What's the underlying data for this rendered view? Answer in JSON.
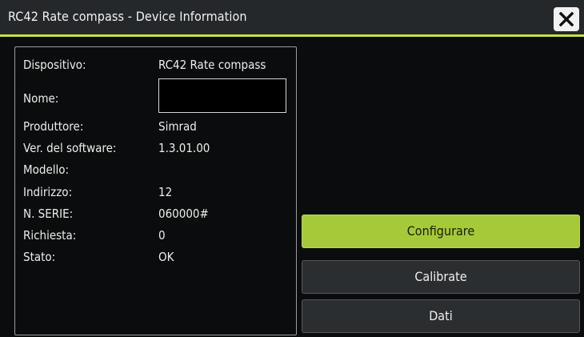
{
  "window": {
    "title": "RC42 Rate compass - Device Information"
  },
  "info": {
    "rows": [
      {
        "label": "Dispositivo:",
        "value": "RC42 Rate compass"
      },
      {
        "label": "Nome:",
        "value": ""
      },
      {
        "label": "Produttore:",
        "value": "Simrad"
      },
      {
        "label": "Ver. del software:",
        "value": "1.3.01.00"
      },
      {
        "label": "Modello:",
        "value": ""
      },
      {
        "label": "Indirizzo:",
        "value": "12"
      },
      {
        "label": "N. SERIE:",
        "value": "060000#"
      },
      {
        "label": "Richiesta:",
        "value": "0"
      },
      {
        "label": "Stato:",
        "value": "OK"
      }
    ],
    "name_field_value": ""
  },
  "actions": {
    "configure_label": "Configurare",
    "calibrate_label": "Calibrate",
    "data_label": "Dati"
  },
  "colors": {
    "accent": "#a6c93a",
    "titlebar_underline": "#c6df55",
    "background": "#0b0c0d"
  },
  "icons": {
    "close": "close-icon"
  }
}
